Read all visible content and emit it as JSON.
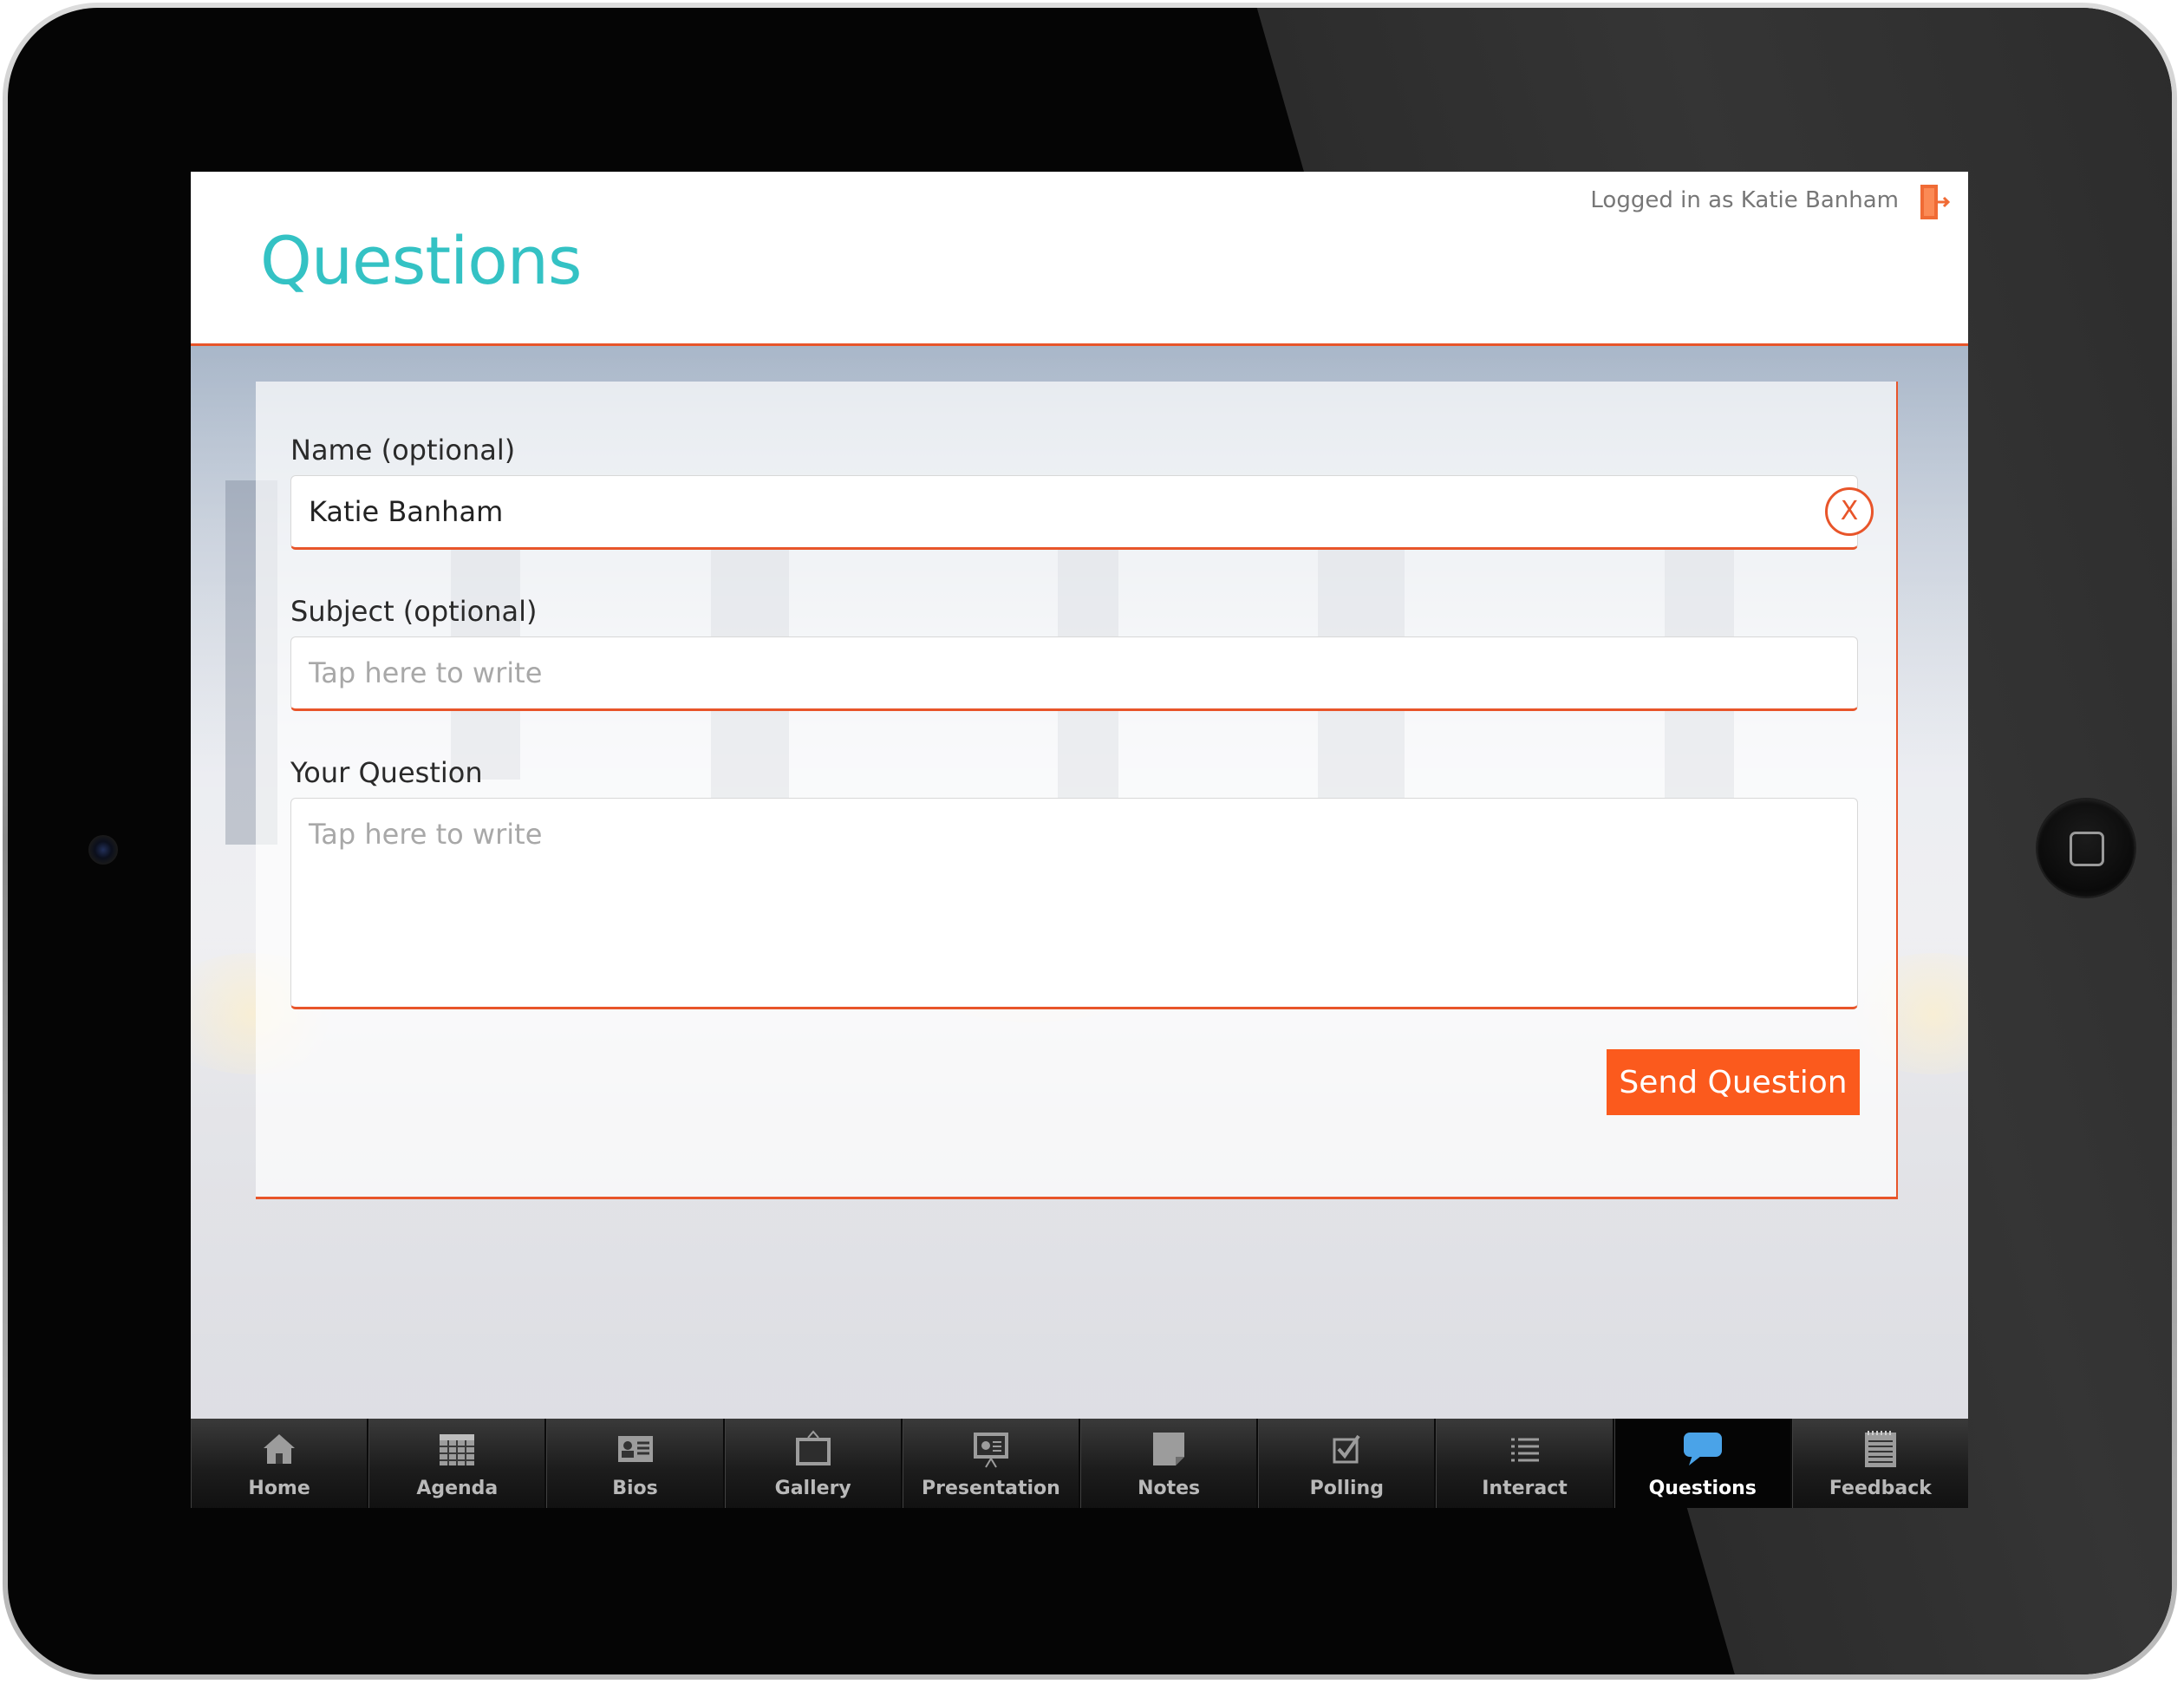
{
  "header": {
    "title": "Questions",
    "login_text": "Logged in as Katie Banham",
    "logout_icon": "logout-door-icon"
  },
  "form": {
    "name": {
      "label": "Name (optional)",
      "value": "Katie Banham",
      "clear_label": "X"
    },
    "subject": {
      "label": "Subject (optional)",
      "placeholder": "Tap here to write"
    },
    "question": {
      "label": "Your Question",
      "placeholder": "Tap here to write"
    },
    "send_label": "Send Question"
  },
  "tabs": [
    {
      "label": "Home",
      "icon": "home-icon"
    },
    {
      "label": "Agenda",
      "icon": "calendar-icon"
    },
    {
      "label": "Bios",
      "icon": "id-card-icon"
    },
    {
      "label": "Gallery",
      "icon": "picture-frame-icon"
    },
    {
      "label": "Presentation",
      "icon": "presentation-board-icon"
    },
    {
      "label": "Notes",
      "icon": "note-icon"
    },
    {
      "label": "Polling",
      "icon": "checkbox-icon"
    },
    {
      "label": "Interact",
      "icon": "list-icon"
    },
    {
      "label": "Questions",
      "icon": "speech-bubble-icon",
      "active": true
    },
    {
      "label": "Feedback",
      "icon": "notepad-icon"
    }
  ],
  "colors": {
    "accent": "#e8552a",
    "button": "#fb5a1d",
    "title": "#34c2c4"
  }
}
